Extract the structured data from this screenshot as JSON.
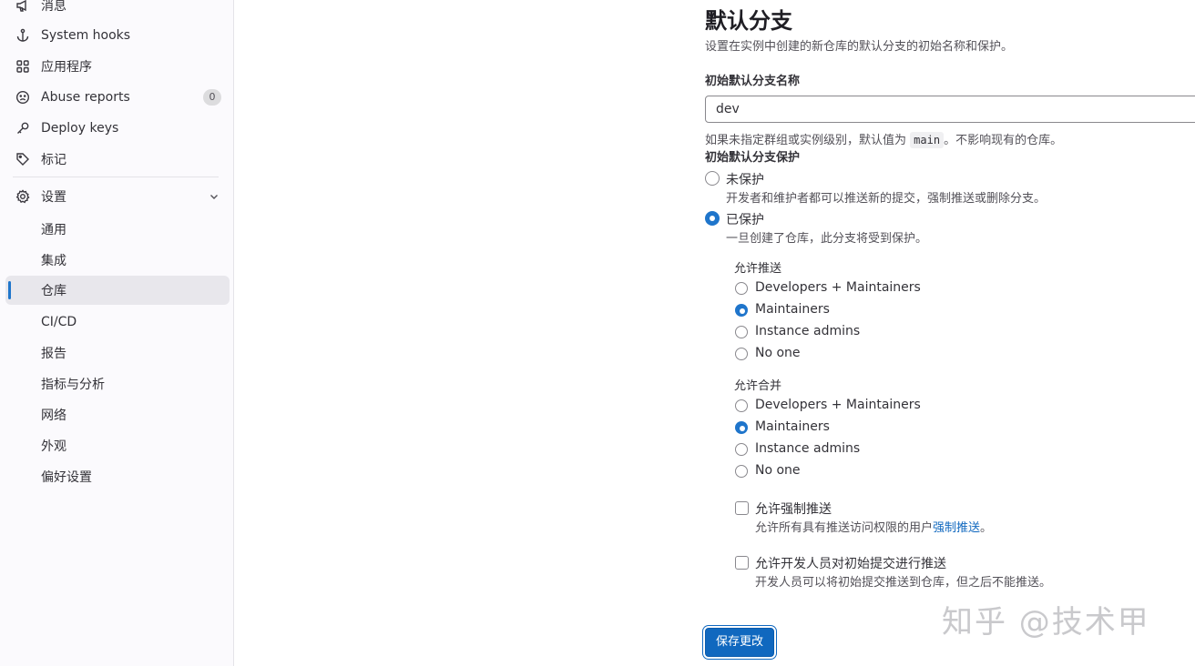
{
  "sidebar": {
    "items": [
      {
        "label": "消息",
        "icon": "megaphone-icon"
      },
      {
        "label": "System hooks",
        "icon": "anchor-icon"
      },
      {
        "label": "应用程序",
        "icon": "applications-icon"
      },
      {
        "label": "Abuse reports",
        "icon": "sad-face-icon",
        "badge": "0"
      },
      {
        "label": "Deploy keys",
        "icon": "key-icon"
      },
      {
        "label": "标记",
        "icon": "label-icon"
      }
    ],
    "settings": {
      "label": "设置",
      "icon": "gear-icon",
      "expanded": true
    },
    "sub_items": [
      {
        "label": "通用"
      },
      {
        "label": "集成"
      },
      {
        "label": "仓库",
        "active": true
      },
      {
        "label": "CI/CD"
      },
      {
        "label": "报告"
      },
      {
        "label": "指标与分析"
      },
      {
        "label": "网络"
      },
      {
        "label": "外观"
      },
      {
        "label": "偏好设置"
      }
    ]
  },
  "main": {
    "title": "默认分支",
    "description": "设置在实例中创建的新仓库的默认分支的初始名称和保护。",
    "branch_name_label": "初始默认分支名称",
    "branch_name_value": "dev",
    "branch_help_prefix": "如果未指定群组或实例级别，默认值为",
    "branch_help_code": "main",
    "branch_help_suffix": "。不影响现有的仓库。",
    "protection_label": "初始默认分支保护",
    "unprotected": {
      "label": "未保护",
      "help": "开发者和维护者都可以推送新的提交，强制推送或删除分支。",
      "selected": false
    },
    "protected": {
      "label": "已保护",
      "help": "一旦创建了仓库，此分支将受到保护。",
      "selected": true
    },
    "allowed_to_push": {
      "label": "允许推送",
      "options": [
        "Developers + Maintainers",
        "Maintainers",
        "Instance admins",
        "No one"
      ],
      "selected": "Maintainers"
    },
    "allowed_to_merge": {
      "label": "允许合并",
      "options": [
        "Developers + Maintainers",
        "Maintainers",
        "Instance admins",
        "No one"
      ],
      "selected": "Maintainers"
    },
    "force_push": {
      "label": "允许强制推送",
      "help_prefix": "允许所有具有推送访问权限的用户",
      "help_link": "强制推送",
      "help_suffix": "。",
      "checked": false
    },
    "dev_initial_push": {
      "label": "允许开发人员对初始提交进行推送",
      "help": "开发人员可以将初始提交推送到仓库，但之后不能推送。",
      "checked": false
    },
    "save_button": "保存更改"
  },
  "watermark": "知乎 @技术甲",
  "colors": {
    "accent": "#1f75cb",
    "button": "#1068bf",
    "link": "#1068bf"
  }
}
